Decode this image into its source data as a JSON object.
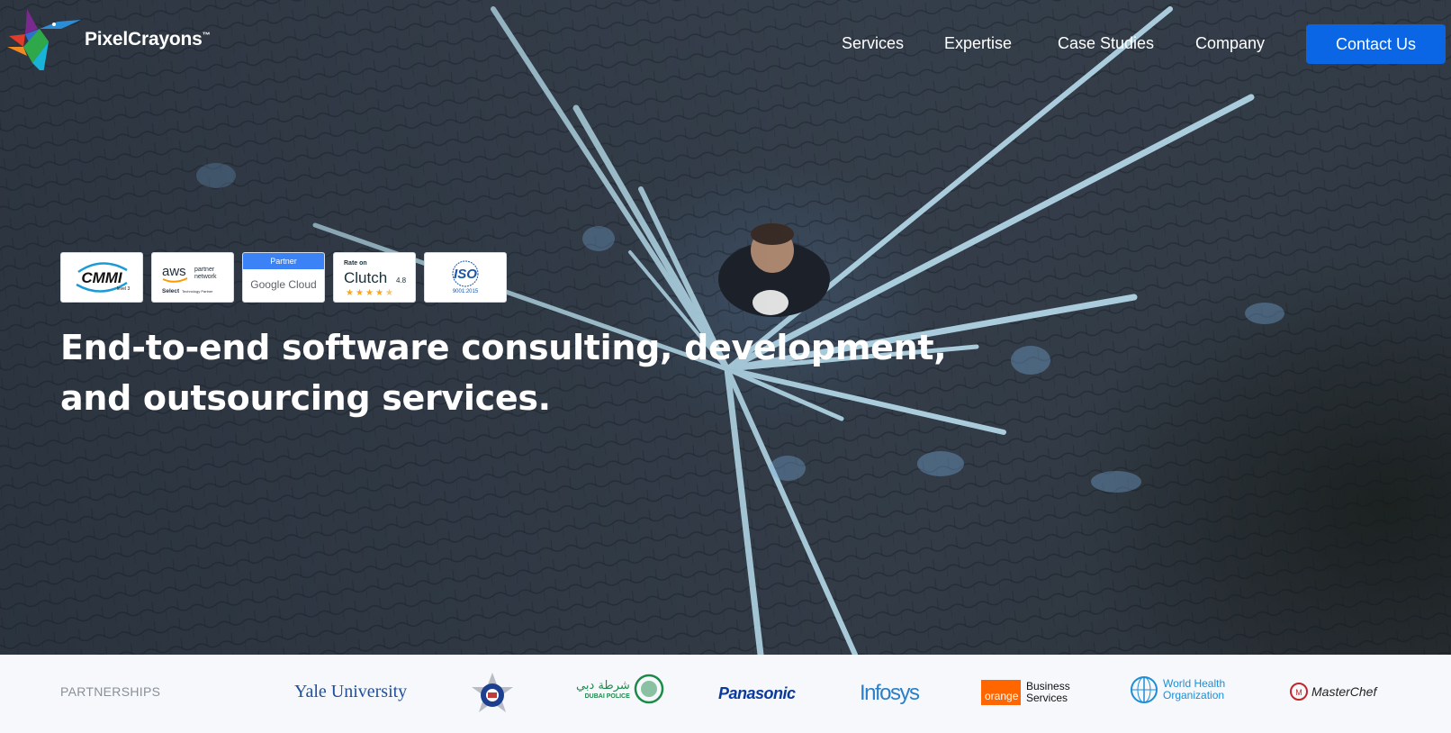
{
  "brand": {
    "name": "PixelCrayons",
    "tm": "™"
  },
  "nav": {
    "items": [
      "Services",
      "Expertise",
      "Case Studies",
      "Company"
    ],
    "contact_label": "Contact Us"
  },
  "badges": {
    "cmmi": {
      "text": "CMMI",
      "level": "level 3"
    },
    "aws": {
      "text": "aws",
      "sub1": "partner",
      "sub2": "network",
      "sub3": "Select",
      "sub4": "Technology Partner"
    },
    "gcloud": {
      "top": "Partner",
      "text": "Google Cloud"
    },
    "clutch": {
      "top": "Rate on",
      "text": "Clutch",
      "rating": "4.8",
      "stars": 4.5
    },
    "iso": {
      "text": "ISO",
      "sub": "9001:2015"
    }
  },
  "hero": {
    "headline_line1": "End-to-end software consulting, development,",
    "headline_line2": "and outsourcing services."
  },
  "partners": {
    "label": "PARTNERSHIPS",
    "yale": "Yale University",
    "dubai_arabic": "شرطة دبي",
    "dubai": "DUBAI POLICE",
    "panasonic": "Panasonic",
    "infosys": "Infosys",
    "orange": "orange",
    "orange_b1": "Business",
    "orange_b2": "Services",
    "who1": "World Health",
    "who2": "Organization",
    "masterchef": "MasterChef"
  },
  "colors": {
    "accent": "#0a66e4",
    "hero_bg": "#353f4b",
    "partners_bg": "#f6f8fb"
  }
}
